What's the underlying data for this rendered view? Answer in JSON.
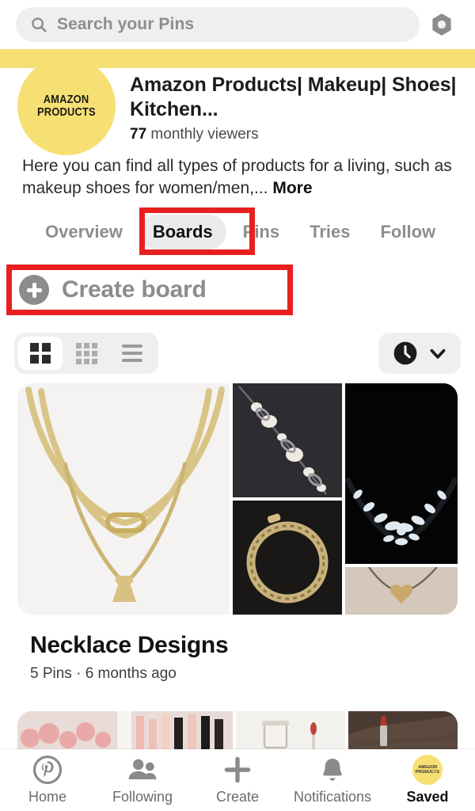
{
  "search": {
    "placeholder": "Search your Pins",
    "icon": "search-icon",
    "settings_icon": "gear-icon"
  },
  "profile": {
    "avatar_line1": "AMAZON",
    "avatar_line2": "PRODUCTS",
    "name": "Amazon Products| Makeup| Shoes| Kitchen...",
    "viewers_count": "77",
    "viewers_label": "monthly viewers",
    "bio": "Here you can find all types of products for a living, such as makeup shoes for women/men,...",
    "bio_more": "More",
    "banner_color": "#f7e073"
  },
  "tabs": [
    {
      "label": "Overview",
      "active": false
    },
    {
      "label": "Boards",
      "active": true
    },
    {
      "label": "Pins",
      "active": false
    },
    {
      "label": "Tries",
      "active": false
    },
    {
      "label": "Follow",
      "active": false
    }
  ],
  "create_board": {
    "label": "Create board",
    "icon": "plus-circle-icon"
  },
  "view_toggle": {
    "options": [
      {
        "name": "grid-2-icon",
        "active": true
      },
      {
        "name": "grid-3-icon",
        "active": false
      },
      {
        "name": "list-icon",
        "active": false
      }
    ]
  },
  "sort": {
    "icon": "clock-icon",
    "chevron": "chevron-down-icon"
  },
  "boards": [
    {
      "title": "Necklace Designs",
      "meta": "5 Pins · 6 months ago",
      "pins": [
        "gold-paperclip-chain-necklace",
        "pearl-beaded-necklace",
        "gold-chain-coil-necklace",
        "diamond-cluster-necklace",
        "gold-heart-pendant-necklace"
      ]
    },
    {
      "title": "",
      "meta": "",
      "pins": [
        "pink-blush-makeup",
        "lip-gloss-collection",
        "cosmetic-jar",
        "lipstick-on-fabric"
      ]
    }
  ],
  "bottom_nav": [
    {
      "label": "Home",
      "icon": "pinterest-logo-icon",
      "active": false
    },
    {
      "label": "Following",
      "icon": "people-icon",
      "active": false
    },
    {
      "label": "Create",
      "icon": "plus-icon",
      "active": false
    },
    {
      "label": "Notifications",
      "icon": "bell-icon",
      "active": false
    },
    {
      "label": "Saved",
      "icon": "profile-avatar-icon",
      "active": true
    }
  ],
  "annotations": {
    "highlight_color": "#e81f1f",
    "boxes": [
      "boards-tab-highlight",
      "create-board-highlight"
    ]
  }
}
